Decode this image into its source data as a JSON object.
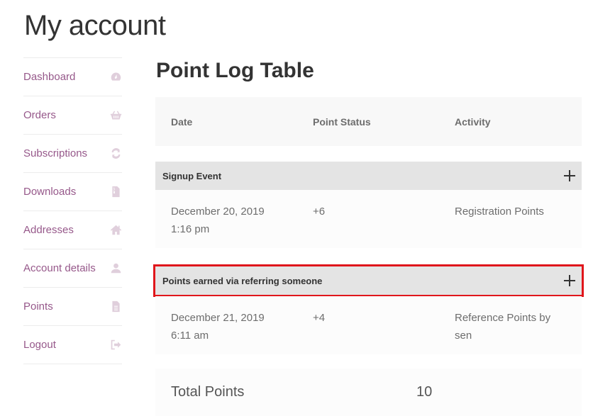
{
  "page": {
    "title": "My account"
  },
  "sidebar": {
    "items": [
      {
        "label": "Dashboard",
        "icon": "dashboard-gauge-icon"
      },
      {
        "label": "Orders",
        "icon": "basket-icon"
      },
      {
        "label": "Subscriptions",
        "icon": "refresh-icon"
      },
      {
        "label": "Downloads",
        "icon": "file-archive-icon"
      },
      {
        "label": "Addresses",
        "icon": "home-icon"
      },
      {
        "label": "Account details",
        "icon": "user-icon"
      },
      {
        "label": "Points",
        "icon": "document-icon"
      },
      {
        "label": "Logout",
        "icon": "sign-out-icon"
      }
    ]
  },
  "main": {
    "title": "Point Log Table",
    "columns": [
      "Date",
      "Point Status",
      "Activity"
    ],
    "groups": [
      {
        "title": "Signup Event",
        "highlighted": false,
        "rows": [
          {
            "date": "December 20, 2019",
            "time": "1:16 pm",
            "points": "+6",
            "activity": "Registration Points"
          }
        ]
      },
      {
        "title": "Points earned via referring someone",
        "highlighted": true,
        "rows": [
          {
            "date": "December 21, 2019",
            "time": "6:11 am",
            "points": "+4",
            "activity": "Reference Points by sen"
          }
        ]
      }
    ],
    "total": {
      "label": "Total Points",
      "value": "10"
    }
  },
  "colors": {
    "link": "#96588a",
    "icon": "#e0cfdc",
    "highlight": "#e0161b"
  }
}
